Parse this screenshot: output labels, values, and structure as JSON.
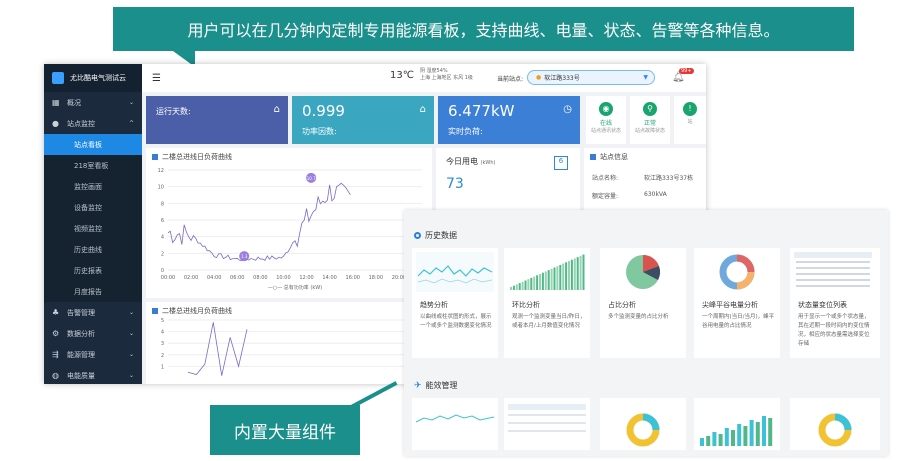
{
  "callouts": {
    "top": "用户可以在几分钟内定制专用能源看板，支持曲线、电量、状态、告警等各种信息。",
    "bottom": "内置大量组件"
  },
  "app": {
    "brand": "尤比酷电气测试云",
    "sidebar": [
      {
        "label": "概况",
        "icon": "dashboard-icon",
        "chev": "⌄"
      },
      {
        "label": "站点监控",
        "icon": "monitor-icon",
        "chev": "^"
      },
      {
        "label": "站点看板",
        "sub": true,
        "active": true
      },
      {
        "label": "218室看板",
        "sub": true
      },
      {
        "label": "监控画面",
        "sub": true
      },
      {
        "label": "设备监控",
        "sub": true
      },
      {
        "label": "视频监控",
        "sub": true
      },
      {
        "label": "历史曲线",
        "sub": true
      },
      {
        "label": "历史报表",
        "sub": true
      },
      {
        "label": "月度报告",
        "sub": true
      },
      {
        "label": "告警管理",
        "icon": "alarm-icon",
        "chev": "⌄"
      },
      {
        "label": "数据分析",
        "icon": "analysis-icon",
        "chev": "⌄"
      },
      {
        "label": "能源管理",
        "icon": "energy-icon",
        "chev": "⌄"
      },
      {
        "label": "电能质量",
        "icon": "quality-icon",
        "chev": "⌄"
      }
    ],
    "topbar": {
      "temp": "13℃",
      "weather_line1": "阴 湿度54%",
      "weather_line2": "上海 上海地区 东风 1级",
      "site_label": "当前站点:",
      "site_value": "软江路333号",
      "badge": "99+"
    },
    "stats": [
      {
        "label": "运行天数:",
        "value": ""
      },
      {
        "label": "功率因数:",
        "value": "0.999"
      },
      {
        "label": "实时负荷:",
        "value": "6.477kW"
      }
    ],
    "status_minis": [
      {
        "state": "在线",
        "label": "站点通讯状态",
        "color": "#1aa56f",
        "icon": "wifi-icon"
      },
      {
        "state": "正常",
        "label": "站点故障状态",
        "color": "#1aa56f",
        "icon": "search-icon"
      },
      {
        "state": "",
        "label": "站",
        "color": "#1aa56f",
        "icon": "status-icon"
      }
    ],
    "daily_chart": {
      "title": "二楼总进线日负荷曲线",
      "legend": "总有功功率 (kW)"
    },
    "monthly_chart": {
      "title": "二楼总进线月负荷曲线"
    },
    "today_energy": {
      "label": "今日用电",
      "unit": "(kWh)",
      "value": "73",
      "cal": "6"
    },
    "site_info": {
      "title": "站点信息",
      "rows": [
        {
          "k": "站点名称:",
          "v": "软江路333号37栋"
        },
        {
          "k": "额定容量:",
          "v": "630kVA"
        }
      ]
    }
  },
  "chart_data": [
    {
      "type": "line",
      "title": "二楼总进线日负荷曲线",
      "x": [
        "00:00",
        "02:00",
        "04:00",
        "06:00",
        "08:00",
        "10:00",
        "12:00",
        "14:00",
        "16:00",
        "18:00",
        "20:00",
        "22:00"
      ],
      "series": [
        {
          "name": "总有功功率 (kW)",
          "values": [
            4.5,
            4.2,
            1.8,
            1.3,
            1.4,
            1.5,
            6,
            9.5,
            8.5,
            null,
            null,
            null
          ]
        }
      ],
      "ylim": [
        0,
        12
      ],
      "annotations": [
        "1.3",
        "10.7"
      ]
    },
    {
      "type": "line",
      "title": "二楼总进线月负荷曲线",
      "x": [
        1,
        2,
        3,
        4,
        5,
        6,
        7,
        8
      ],
      "series": [
        {
          "name": "",
          "values": [
            0.5,
            0.3,
            1.2,
            4.8,
            0.2,
            3.5,
            1.0,
            4.2
          ]
        }
      ],
      "ylim": [
        0,
        5
      ]
    }
  ],
  "overlay": {
    "history_title": "历史数据",
    "tiles": [
      {
        "name": "趋势分析",
        "desc": "以曲线或柱状图的形式，展示一个或多个监测数据变化情况"
      },
      {
        "name": "环比分析",
        "desc": "观测一个监测变量当日/昨日，或者本月/上月数值变化情况"
      },
      {
        "name": "占比分析",
        "desc": "多个监测变量的占比分析"
      },
      {
        "name": "尖峰平谷电量分析",
        "desc": "一个周期内(当日/当月)，峰平谷用电量的占比情况"
      },
      {
        "name": "状态量变位列表",
        "desc": "用于显示一个或多个状态量，其在近期一段时间内的变位情况，相应的状态量需选择变位存储"
      }
    ],
    "energy_title": "能效管理"
  }
}
